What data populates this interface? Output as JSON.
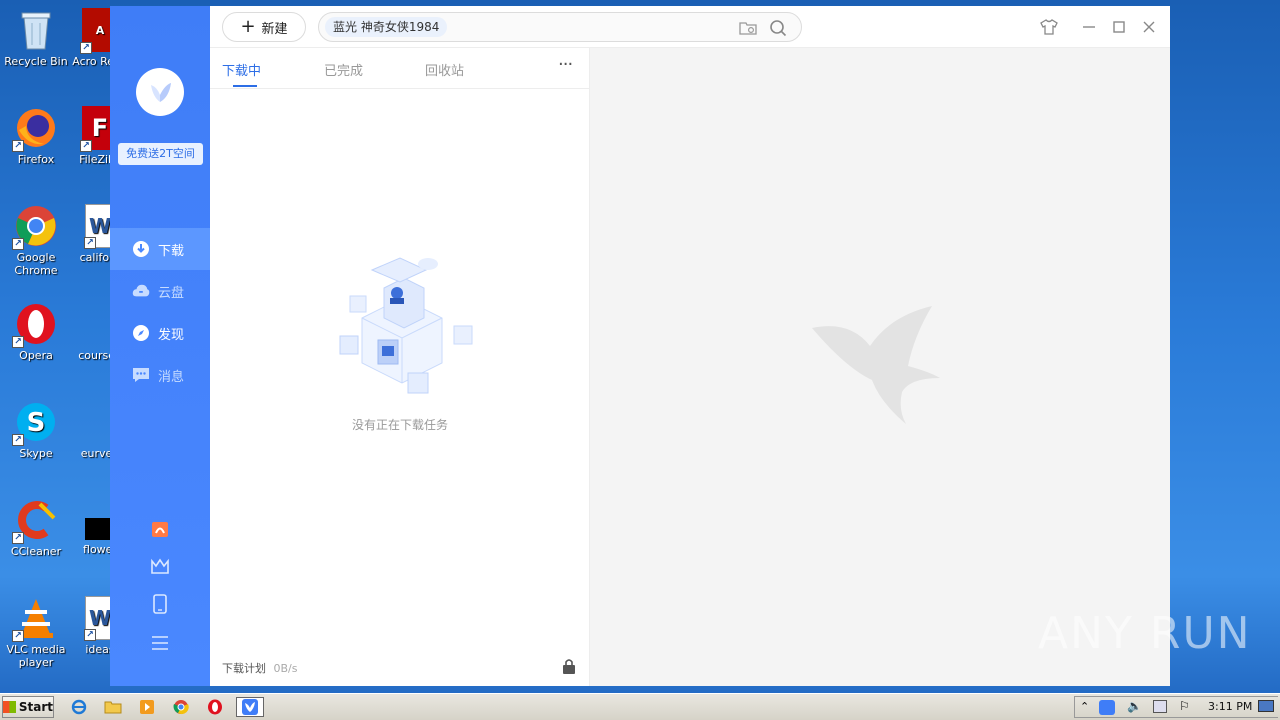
{
  "desktop": {
    "icons": [
      {
        "label": "Recycle Bin"
      },
      {
        "label": "Acro Read"
      },
      {
        "label": "Firefox"
      },
      {
        "label": "FileZilla"
      },
      {
        "label": "Google Chrome"
      },
      {
        "label": "californ"
      },
      {
        "label": "Opera"
      },
      {
        "label": "coursee"
      },
      {
        "label": "Skype"
      },
      {
        "label": "eurven"
      },
      {
        "label": "CCleaner"
      },
      {
        "label": "flower"
      },
      {
        "label": "VLC media player"
      },
      {
        "label": "ideas"
      }
    ],
    "watermark": "ANY RUN"
  },
  "app": {
    "sidebar": {
      "promo": "免费送2T空间",
      "items": [
        {
          "label": "下载",
          "icon": "download-icon",
          "active": true
        },
        {
          "label": "云盘",
          "icon": "cloud-icon"
        },
        {
          "label": "发现",
          "icon": "compass-icon"
        },
        {
          "label": "消息",
          "icon": "message-icon"
        }
      ],
      "tools": [
        "gift-icon",
        "crown-icon",
        "tablet-icon",
        "menu-icon"
      ]
    },
    "toolbar": {
      "new_label": "新建",
      "search_tag": "蓝光  神奇女侠1984"
    },
    "tabs": [
      {
        "label": "下载中"
      },
      {
        "label": "已完成"
      },
      {
        "label": "回收站"
      }
    ],
    "more": "···",
    "empty_text": "没有正在下载任务",
    "footer": {
      "plan": "下载计划",
      "speed": "0B/s"
    }
  },
  "taskbar": {
    "start": "Start",
    "clock": "3:11 PM"
  }
}
